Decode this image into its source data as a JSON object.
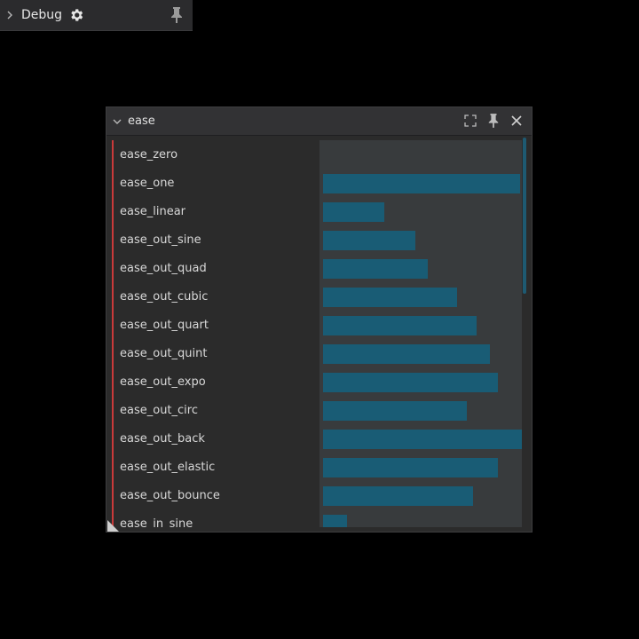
{
  "debug": {
    "title": "Debug",
    "icons": {
      "expand": "chevron-right-icon",
      "settings": "gear-icon",
      "pin": "pin-icon"
    }
  },
  "window": {
    "title": "ease",
    "icons": {
      "collapse": "chevron-down-icon",
      "maximize": "maximize-icon",
      "pin": "pin-icon",
      "close": "close-icon"
    }
  },
  "colors": {
    "accent": "#c93a3a",
    "bar": "#195c75",
    "track": "#383b3d",
    "background": "#2b2b2b"
  },
  "rows": [
    {
      "label": "ease_zero",
      "value": 0.0
    },
    {
      "label": "ease_one",
      "value": 1.0
    },
    {
      "label": "ease_linear",
      "value": 0.31
    },
    {
      "label": "ease_out_sine",
      "value": 0.47
    },
    {
      "label": "ease_out_quad",
      "value": 0.53
    },
    {
      "label": "ease_out_cubic",
      "value": 0.68
    },
    {
      "label": "ease_out_quart",
      "value": 0.78
    },
    {
      "label": "ease_out_quint",
      "value": 0.85
    },
    {
      "label": "ease_out_expo",
      "value": 0.89
    },
    {
      "label": "ease_out_circ",
      "value": 0.73
    },
    {
      "label": "ease_out_back",
      "value": 1.02
    },
    {
      "label": "ease_out_elastic",
      "value": 0.89
    },
    {
      "label": "ease_out_bounce",
      "value": 0.76
    },
    {
      "label": "ease_in_sine",
      "value": 0.12
    }
  ]
}
